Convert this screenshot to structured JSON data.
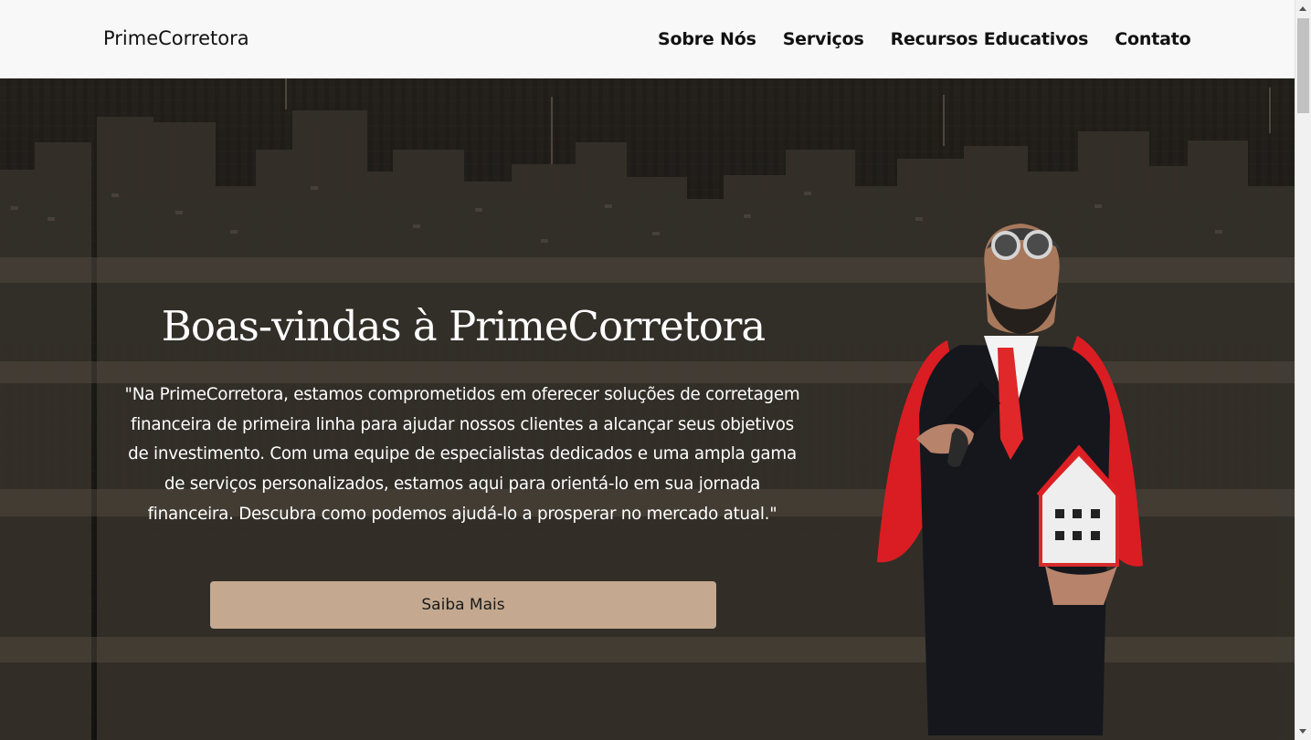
{
  "header": {
    "brand": "PrimeCorretora",
    "nav": [
      {
        "label": "Sobre Nós"
      },
      {
        "label": "Serviços"
      },
      {
        "label": "Recursos Educativos"
      },
      {
        "label": "Contato"
      }
    ]
  },
  "hero": {
    "title": "Boas-vindas à PrimeCorretora",
    "description": "\"Na PrimeCorretora, estamos comprometidos em oferecer soluções de corretagem financeira de primeira linha para ajudar nossos clientes a alcançar seus objetivos de investimento. Com uma equipe de especialistas dedicados e uma ampla gama de serviços personalizados, estamos aqui para orientá-lo em sua jornada financeira. Descubra como podemos ajudá-lo a prosperar no mercado atual.\"",
    "button_label": "Saiba Mais"
  },
  "colors": {
    "navbar_background": "#f8f8f8",
    "hero_overlay": "#171614",
    "button_background": "#c4a990",
    "text_light": "#ffffff",
    "cape_red": "#dd1d22"
  },
  "icons": {
    "scroll_up": "scroll-up-icon",
    "scroll_down": "scroll-down-icon"
  }
}
